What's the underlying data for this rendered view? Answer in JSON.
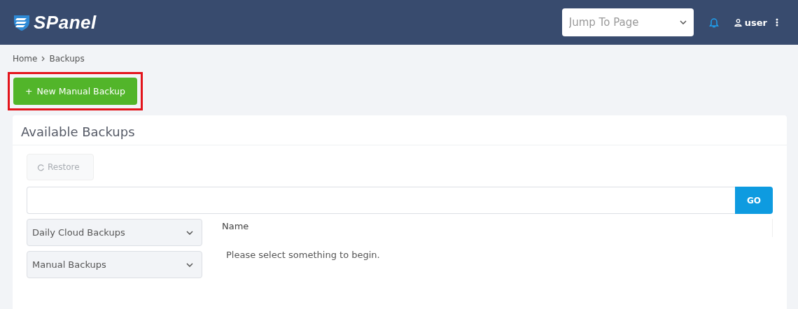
{
  "header": {
    "logo": "SPanel",
    "jump": {
      "placeholder": "Jump To Page"
    },
    "user": "user"
  },
  "breadcrumb": [
    "Home",
    "Backups"
  ],
  "new_backup_button": {
    "label": "New Manual Backup",
    "icon": "+",
    "highlighted": true
  },
  "card": {
    "title": "Available Backups",
    "restore_button": {
      "label": "Restore",
      "disabled": true
    },
    "search": {
      "button": "GO"
    },
    "selects": [
      "Daily Cloud Backups",
      "Manual Backups"
    ],
    "table": {
      "columns": [
        "Name"
      ],
      "empty_message": "Please select something to begin."
    }
  }
}
